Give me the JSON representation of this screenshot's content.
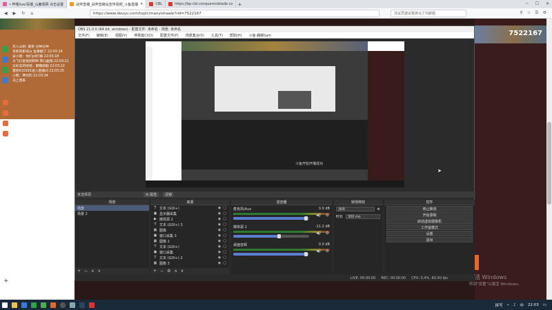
{
  "browser": {
    "tabs": [
      {
        "label": "• 哔哩live/百播_山鹿观网 点击设置",
        "color": "#e85a9b",
        "active": false
      },
      {
        "label": "战斧直播_战斧直播站宣传视频_斗鱼直播",
        "color": "#f39a1e",
        "active": true
      },
      {
        "label": "CBL",
        "color": "#d33",
        "active": false
      },
      {
        "label": "https://bp-cbl.conquerorsblade.co",
        "color": "#d33",
        "active": false
      }
    ],
    "url": "https://www.douyu.com/topic/manyishaale?rid=7522167",
    "search_placeholder": "法议员建议我将马丁内斯姐",
    "close_glyph": "✕",
    "window_controls": [
      "─",
      "☐",
      "✕"
    ]
  },
  "left_chat": {
    "messages": [
      {
        "user": "[宝石]",
        "text": "东八山树: 宽有 分钟分钟"
      },
      {
        "user": "[宝石]",
        "text": "京民的影响从 鱼香翻了 22:03:14"
      },
      {
        "user": "[宝石]",
        "text": "安小嗯：你们yd打解 22:03:18"
      },
      {
        "user": "[宝石]",
        "text": "大飞打金钱到888 贺口曲阳 22:03:21"
      },
      {
        "user": "[宝石]",
        "text": "云彩实的哈哈：钢镯想剧 22:03:22"
      },
      {
        "user": "[宝石]",
        "text": "慧修610191进入直播间 22:03:25"
      },
      {
        "user": "[宝石]",
        "text": "小嗯：神可的 22:03:34"
      },
      {
        "user": "[宝石]",
        "text": "马上回来"
      }
    ]
  },
  "right_page": {
    "viewer_count": "7522167",
    "activate_title": "激活 Windows",
    "activate_sub": "转到\"设置\"以激活 Windows。"
  },
  "obs": {
    "title": "OBS 21.0.0 (64 bit, windows) - 配置文件: 未命名 - 场景: 未命名",
    "menu": [
      "文件(F)",
      "编辑(E)",
      "视图(V)",
      "停靠窗口(D)",
      "配置文件(P)",
      "场景集合(S)",
      "工具(T)",
      "帮助(H)",
      "斗鱼·蝴蝶Sam"
    ],
    "preview_toast": "斗鱼开始开播成功",
    "scene_bar": {
      "label": "未选择源",
      "properties": "⚙ 属性",
      "filters": "滤镜"
    },
    "docks": {
      "scenes": {
        "title": "场景",
        "items": [
          "场景",
          "场景 2"
        ]
      },
      "sources": {
        "title": "来源",
        "items": [
          {
            "icon": "T",
            "label": "文本 (GDI+)"
          },
          {
            "icon": "▣",
            "label": "显示器采集"
          },
          {
            "icon": "▶",
            "label": "媒体源 2"
          },
          {
            "icon": "T",
            "label": "文本 (GDI+) 3"
          },
          {
            "icon": "▦",
            "label": "图像"
          },
          {
            "icon": "▣",
            "label": "窗口采集 3"
          },
          {
            "icon": "▦",
            "label": "图像 2"
          },
          {
            "icon": "T",
            "label": "文本 (GDI+)"
          },
          {
            "icon": "▣",
            "label": "窗口采集"
          },
          {
            "icon": "T",
            "label": "文本 (GDI+) 2"
          },
          {
            "icon": "▦",
            "label": "图像 3"
          }
        ]
      },
      "mixer": {
        "title": "混音器",
        "channels": [
          {
            "name": "麦克风/Aux",
            "db": "0.0 dB",
            "level": 0.95
          },
          {
            "name": "媒体源 2",
            "db": "-11.2 dB",
            "level": 0.6
          },
          {
            "name": "桌面音频",
            "db": "0.0 dB",
            "level": 0.95
          }
        ]
      },
      "transitions": {
        "title": "转场特效",
        "selected": "淡出",
        "duration_label": "时长",
        "duration": "300 ms"
      },
      "controls": {
        "title": "控件",
        "buttons": [
          "停止推流",
          "开始录制",
          "启动虚拟摄像机",
          "工作室模式",
          "设置",
          "退出"
        ]
      }
    },
    "status": {
      "live": "LIVE: 00:00:00",
      "rec": "REC: 00:00:00",
      "cpu": "CPU: 0.4%, 60.00 fps"
    }
  },
  "taskbar": {
    "time": "22:03",
    "lang": "中",
    "tray_label": "拼写"
  },
  "colors": {
    "accent": "#e8662a",
    "obs_bg": "#2b2b2b",
    "chat_bg": "#b06a37"
  }
}
